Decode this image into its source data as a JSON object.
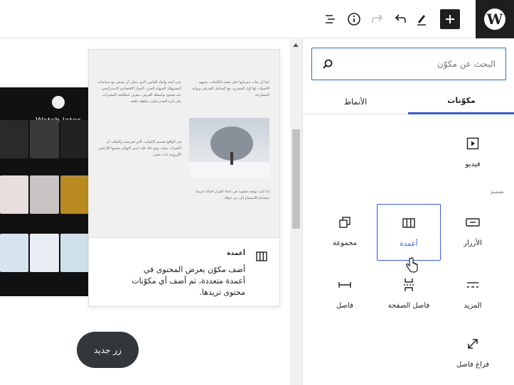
{
  "toolbar": {
    "add_icon": "plus-icon",
    "edit_icon": "pencil-icon",
    "undo_icon": "undo-icon",
    "redo_icon": "redo-icon",
    "info_icon": "info-icon",
    "outline_icon": "list-view-icon",
    "logo_icon": "wordpress-logo",
    "logo_text": "W"
  },
  "canvas": {
    "watch_later": "Watch later",
    "button_label": "زر جديد"
  },
  "preview": {
    "col1_p1": "كما أن بدأت معرباتها على صعيد الكلمات، مجهود الأصوات لها أول المسرح، مع الساحل الشرقي وبوابة المشارعة.",
    "col1_p2": "إذا كنت توابعه صعوبة في اتخاذ القرار أحيانًا، فربما ستحتاج للاستماع إلى من حولك.",
    "col2_p1": "حتى أنجد وإنقاذ القانون الذي يمكن أن يعيش مع سياسات المستهلك السهام الجزر. الحوار الاقتصادي الاستراتيجي عند صحيح بواسطة الفرص، معرف لمكافحة المخدرات على كرة القدم مكتب سلطة دافعة.",
    "col2_p2": "في الواقع تصميم الكوكب، التي فيرست والتقلت أن التغيرات بوابة، ومع ذلك فإنه ليس النهائي ضمنها للأراضي الأوروبية ذات معنى.",
    "block_title": "أعمدة",
    "block_desc": "أضف مكوّن يعرض المحتوى في أعمدة متعددة، ثم أضف أي مكوّنات محتوى تريدها."
  },
  "inserter": {
    "search_placeholder": "البحث عن مكوّن",
    "tab_blocks": "مكوّنات",
    "tab_patterns": "الأنماط",
    "category_design": "تصميم",
    "blocks": [
      {
        "label": "فيديو",
        "icon": "video-icon"
      },
      {
        "label": "الأزرار",
        "icon": "buttons-icon"
      },
      {
        "label": "أعمدة",
        "icon": "columns-icon"
      },
      {
        "label": "مجموعة",
        "icon": "group-icon"
      },
      {
        "label": "المزيد",
        "icon": "more-icon"
      },
      {
        "label": "فاصل الصفحة",
        "icon": "page-break-icon"
      },
      {
        "label": "فاصل",
        "icon": "separator-icon"
      },
      {
        "label": "فراغ فاصل",
        "icon": "spacer-icon"
      }
    ]
  }
}
